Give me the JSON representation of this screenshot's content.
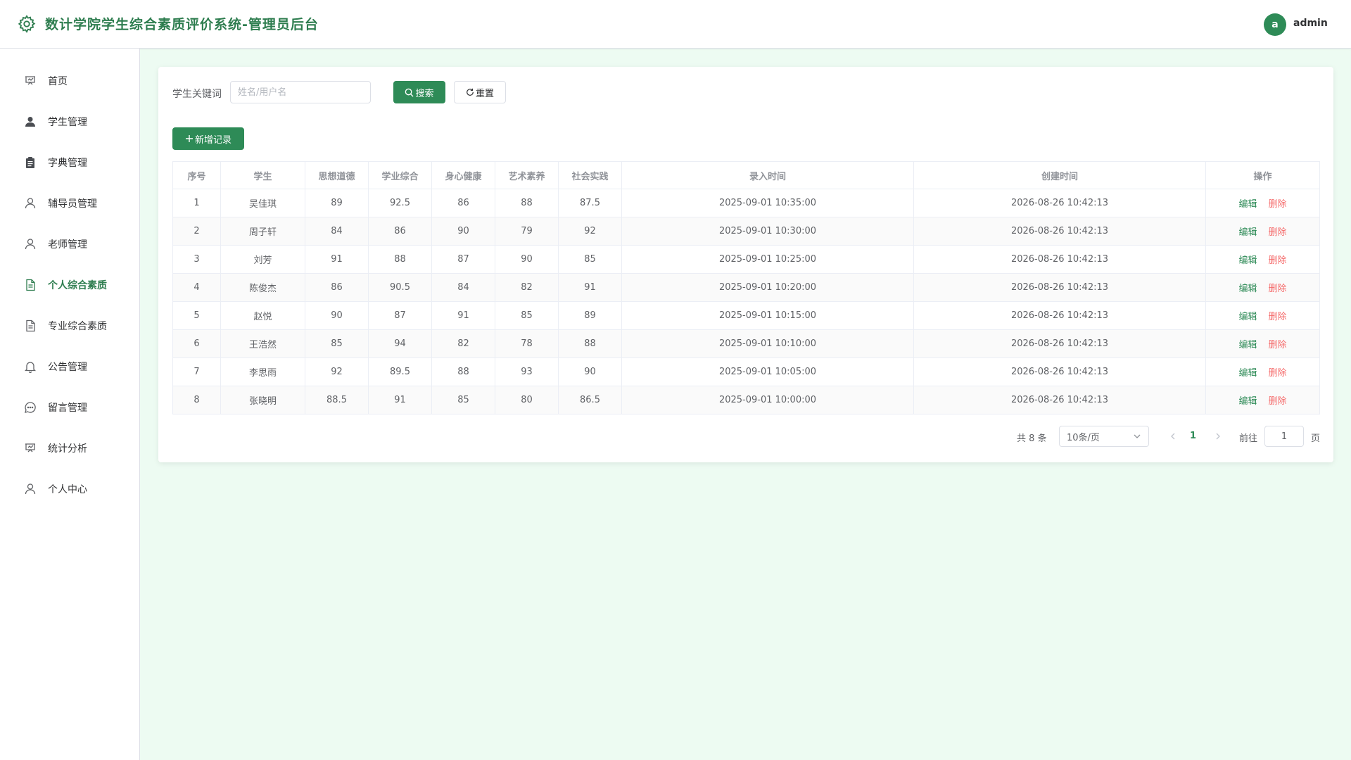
{
  "colors": {
    "accent": "#2e8b57",
    "title": "#2e7d4f",
    "danger": "#f56c6c",
    "background": "#edfbf2"
  },
  "header": {
    "title": "数计学院学生综合素质评价系统-管理员后台",
    "avatar_letter": "a",
    "username": "admin"
  },
  "sidebar": {
    "items": [
      {
        "label": "首页",
        "icon": "presentation-icon",
        "active": false
      },
      {
        "label": "学生管理",
        "icon": "user-filled-icon",
        "active": false
      },
      {
        "label": "字典管理",
        "icon": "clipboard-icon",
        "active": false
      },
      {
        "label": "辅导员管理",
        "icon": "user-icon",
        "active": false
      },
      {
        "label": "老师管理",
        "icon": "user-icon",
        "active": false
      },
      {
        "label": "个人综合素质",
        "icon": "document-icon",
        "active": true
      },
      {
        "label": "专业综合素质",
        "icon": "document-icon",
        "active": false
      },
      {
        "label": "公告管理",
        "icon": "bell-icon",
        "active": false
      },
      {
        "label": "留言管理",
        "icon": "chat-icon",
        "active": false
      },
      {
        "label": "统计分析",
        "icon": "presentation-icon",
        "active": false
      },
      {
        "label": "个人中心",
        "icon": "user-icon",
        "active": false
      }
    ]
  },
  "search": {
    "label": "学生关键词",
    "placeholder": "姓名/用户名",
    "value": "",
    "search_label": "搜索",
    "reset_label": "重置"
  },
  "toolbar": {
    "add_label": "新增记录"
  },
  "table": {
    "columns": [
      "序号",
      "学生",
      "思想道德",
      "学业综合",
      "身心健康",
      "艺术素养",
      "社会实践",
      "录入时间",
      "创建时间",
      "操作"
    ],
    "rows": [
      [
        "1",
        "吴佳琪",
        "89",
        "92.5",
        "86",
        "88",
        "87.5",
        "2025-09-01 10:35:00",
        "2026-08-26 10:42:13"
      ],
      [
        "2",
        "周子轩",
        "84",
        "86",
        "90",
        "79",
        "92",
        "2025-09-01 10:30:00",
        "2026-08-26 10:42:13"
      ],
      [
        "3",
        "刘芳",
        "91",
        "88",
        "87",
        "90",
        "85",
        "2025-09-01 10:25:00",
        "2026-08-26 10:42:13"
      ],
      [
        "4",
        "陈俊杰",
        "86",
        "90.5",
        "84",
        "82",
        "91",
        "2025-09-01 10:20:00",
        "2026-08-26 10:42:13"
      ],
      [
        "5",
        "赵悦",
        "90",
        "87",
        "91",
        "85",
        "89",
        "2025-09-01 10:15:00",
        "2026-08-26 10:42:13"
      ],
      [
        "6",
        "王浩然",
        "85",
        "94",
        "82",
        "78",
        "88",
        "2025-09-01 10:10:00",
        "2026-08-26 10:42:13"
      ],
      [
        "7",
        "李思雨",
        "92",
        "89.5",
        "88",
        "93",
        "90",
        "2025-09-01 10:05:00",
        "2026-08-26 10:42:13"
      ],
      [
        "8",
        "张晓明",
        "88.5",
        "91",
        "85",
        "80",
        "86.5",
        "2025-09-01 10:00:00",
        "2026-08-26 10:42:13"
      ]
    ],
    "edit_label": "编辑",
    "delete_label": "删除"
  },
  "pagination": {
    "total_text": "共 8 条",
    "page_size": "10条/页",
    "current_page": "1",
    "goto_label": "前往",
    "goto_value": "1",
    "page_unit": "页"
  }
}
